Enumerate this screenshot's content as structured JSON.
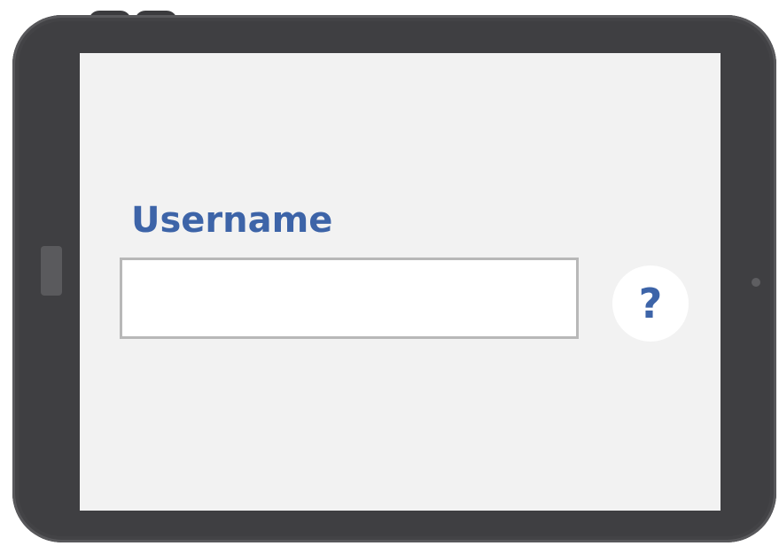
{
  "login_form": {
    "username_label": "Username",
    "username_value": "",
    "help_button_glyph": "?",
    "help_icon": "question-mark-icon"
  },
  "colors": {
    "accent": "#3d64a8",
    "device_frame": "#3f3f42",
    "screen_background": "#f2f2f2",
    "input_border": "#b8b8b8"
  }
}
